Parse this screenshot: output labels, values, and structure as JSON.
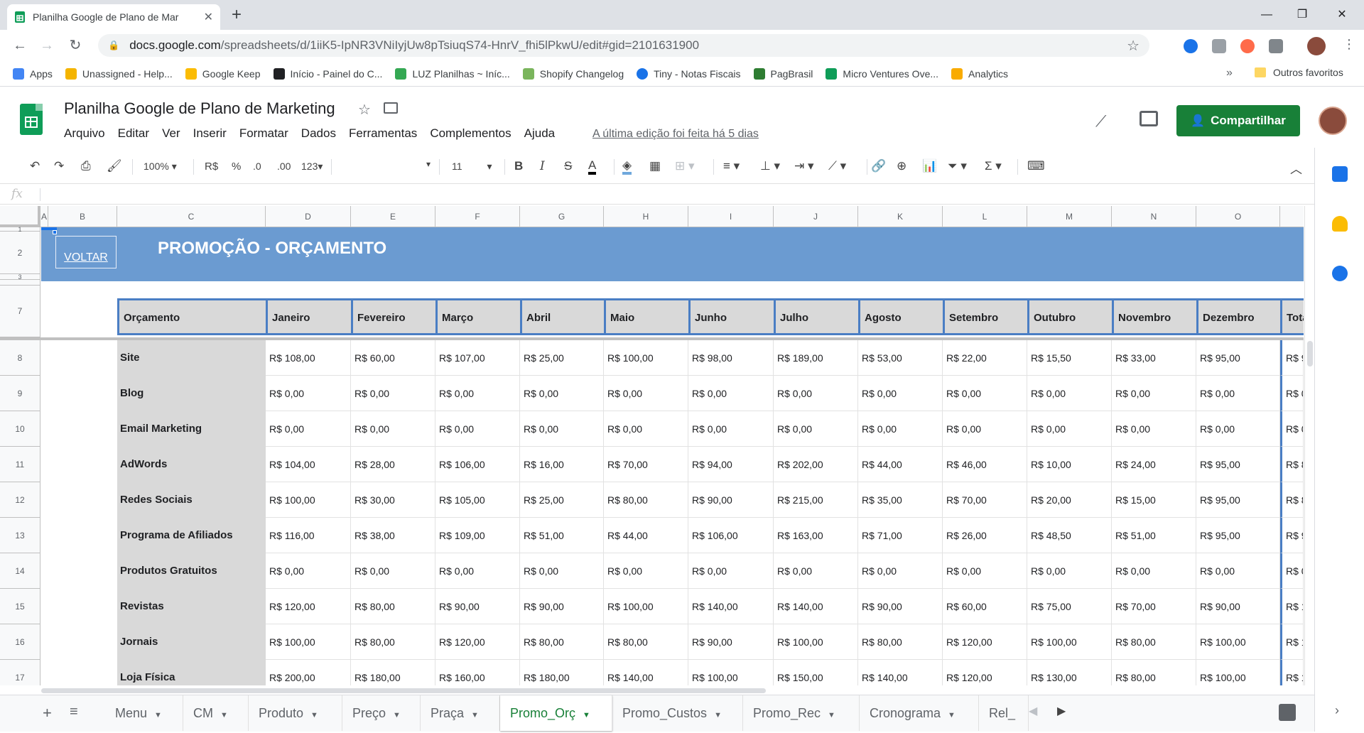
{
  "browser": {
    "tab_title": "Planilha Google de Plano de Mar",
    "url_host": "docs.google.com",
    "url_path": "/spreadsheets/d/1iiK5-IpNR3VNiIyjUw8pTsiuqS74-HnrV_fhi5lPkwU/edit#gid=2101631900",
    "bookmarks": [
      {
        "label": "Apps",
        "color": "#4285f4"
      },
      {
        "label": "Unassigned - Help...",
        "color": "#f4b400"
      },
      {
        "label": "Google Keep",
        "color": "#fbbc04"
      },
      {
        "label": "Início - Painel do C...",
        "color": "#202124"
      },
      {
        "label": "LUZ Planilhas ~ Iníc...",
        "color": "#34a853"
      },
      {
        "label": "Shopify Changelog",
        "color": "#7ab55c"
      },
      {
        "label": "Tiny - Notas Fiscais",
        "color": "#1a73e8"
      },
      {
        "label": "PagBrasil",
        "color": "#2e7d32"
      },
      {
        "label": "Micro Ventures Ove...",
        "color": "#0f9d58"
      },
      {
        "label": "Analytics",
        "color": "#f9ab00"
      }
    ],
    "bookmarks_more": "»",
    "other_bookmarks": "Outros favoritos"
  },
  "sheets": {
    "doc_title": "Planilha Google de Plano de Marketing",
    "menu": [
      "Arquivo",
      "Editar",
      "Ver",
      "Inserir",
      "Formatar",
      "Dados",
      "Ferramentas",
      "Complementos",
      "Ajuda"
    ],
    "last_edit": "A última edição foi feita há 5 dias",
    "share_label": "Compartilhar",
    "accent": "#188038"
  },
  "toolbar": {
    "zoom": "100%",
    "currency": "R$",
    "percent": "%",
    "dec_less": ".0",
    "dec_more": ".00",
    "format_more": "123",
    "font_size": "11"
  },
  "formula": {
    "fx": "fx"
  },
  "grid": {
    "columns": [
      "A",
      "B",
      "C",
      "D",
      "E",
      "F",
      "G",
      "H",
      "I",
      "J",
      "K",
      "L",
      "M",
      "N",
      "O"
    ],
    "row_numbers": [
      "1",
      "2",
      "3",
      "",
      "7",
      "8",
      "9",
      "10",
      "11",
      "12",
      "13",
      "14",
      "15",
      "16",
      "17"
    ],
    "banner_color": "#6b9bd1",
    "voltar": "VOLTAR",
    "banner_title": "PROMOÇÃO - ORÇAMENTO"
  },
  "table": {
    "headers": [
      "Orçamento",
      "Janeiro",
      "Fevereiro",
      "Março",
      "Abril",
      "Maio",
      "Junho",
      "Julho",
      "Agosto",
      "Setembro",
      "Outubro",
      "Novembro",
      "Dezembro",
      "Tota"
    ],
    "rows": [
      {
        "label": "Site",
        "values": [
          "R$ 108,00",
          "R$ 60,00",
          "R$ 107,00",
          "R$ 25,00",
          "R$ 100,00",
          "R$ 98,00",
          "R$ 189,00",
          "R$ 53,00",
          "R$ 22,00",
          "R$ 15,50",
          "R$ 33,00",
          "R$ 95,00",
          "R$ 9"
        ]
      },
      {
        "label": "Blog",
        "values": [
          "R$ 0,00",
          "R$ 0,00",
          "R$ 0,00",
          "R$ 0,00",
          "R$ 0,00",
          "R$ 0,00",
          "R$ 0,00",
          "R$ 0,00",
          "R$ 0,00",
          "R$ 0,00",
          "R$ 0,00",
          "R$ 0,00",
          "R$ 0"
        ]
      },
      {
        "label": "Email Marketing",
        "values": [
          "R$ 0,00",
          "R$ 0,00",
          "R$ 0,00",
          "R$ 0,00",
          "R$ 0,00",
          "R$ 0,00",
          "R$ 0,00",
          "R$ 0,00",
          "R$ 0,00",
          "R$ 0,00",
          "R$ 0,00",
          "R$ 0,00",
          "R$ 0"
        ]
      },
      {
        "label": "AdWords",
        "values": [
          "R$ 104,00",
          "R$ 28,00",
          "R$ 106,00",
          "R$ 16,00",
          "R$ 70,00",
          "R$ 94,00",
          "R$ 202,00",
          "R$ 44,00",
          "R$ 46,00",
          "R$ 10,00",
          "R$ 24,00",
          "R$ 95,00",
          "R$ 8"
        ]
      },
      {
        "label": "Redes Sociais",
        "values": [
          "R$ 100,00",
          "R$ 30,00",
          "R$ 105,00",
          "R$ 25,00",
          "R$ 80,00",
          "R$ 90,00",
          "R$ 215,00",
          "R$ 35,00",
          "R$ 70,00",
          "R$ 20,00",
          "R$ 15,00",
          "R$ 95,00",
          "R$ 8"
        ]
      },
      {
        "label": "Programa de Afiliados",
        "values": [
          "R$ 116,00",
          "R$ 38,00",
          "R$ 109,00",
          "R$ 51,00",
          "R$ 44,00",
          "R$ 106,00",
          "R$ 163,00",
          "R$ 71,00",
          "R$ 26,00",
          "R$ 48,50",
          "R$ 51,00",
          "R$ 95,00",
          "R$ 9"
        ]
      },
      {
        "label": "Produtos Gratuitos",
        "values": [
          "R$ 0,00",
          "R$ 0,00",
          "R$ 0,00",
          "R$ 0,00",
          "R$ 0,00",
          "R$ 0,00",
          "R$ 0,00",
          "R$ 0,00",
          "R$ 0,00",
          "R$ 0,00",
          "R$ 0,00",
          "R$ 0,00",
          "R$ 0"
        ]
      },
      {
        "label": "Revistas",
        "values": [
          "R$ 120,00",
          "R$ 80,00",
          "R$ 90,00",
          "R$ 90,00",
          "R$ 100,00",
          "R$ 140,00",
          "R$ 140,00",
          "R$ 90,00",
          "R$ 60,00",
          "R$ 75,00",
          "R$ 70,00",
          "R$ 90,00",
          "R$ 1"
        ]
      },
      {
        "label": "Jornais",
        "values": [
          "R$ 100,00",
          "R$ 80,00",
          "R$ 120,00",
          "R$ 80,00",
          "R$ 80,00",
          "R$ 90,00",
          "R$ 100,00",
          "R$ 80,00",
          "R$ 120,00",
          "R$ 100,00",
          "R$ 80,00",
          "R$ 100,00",
          "R$ 1"
        ]
      },
      {
        "label": "Loja Física",
        "values": [
          "R$ 200,00",
          "R$ 180,00",
          "R$ 160,00",
          "R$ 180,00",
          "R$ 140,00",
          "R$ 100,00",
          "R$ 150,00",
          "R$ 140,00",
          "R$ 120,00",
          "R$ 130,00",
          "R$ 80,00",
          "R$ 100,00",
          "R$ 1"
        ]
      }
    ]
  },
  "sheet_tabs": [
    {
      "label": "Menu",
      "active": false
    },
    {
      "label": "CM",
      "active": false
    },
    {
      "label": "Produto",
      "active": false
    },
    {
      "label": "Preço",
      "active": false
    },
    {
      "label": "Praça",
      "active": false
    },
    {
      "label": "Promo_Orç",
      "active": true
    },
    {
      "label": "Promo_Custos",
      "active": false
    },
    {
      "label": "Promo_Rec",
      "active": false
    },
    {
      "label": "Cronograma",
      "active": false
    },
    {
      "label": "Rel_",
      "active": false
    }
  ]
}
